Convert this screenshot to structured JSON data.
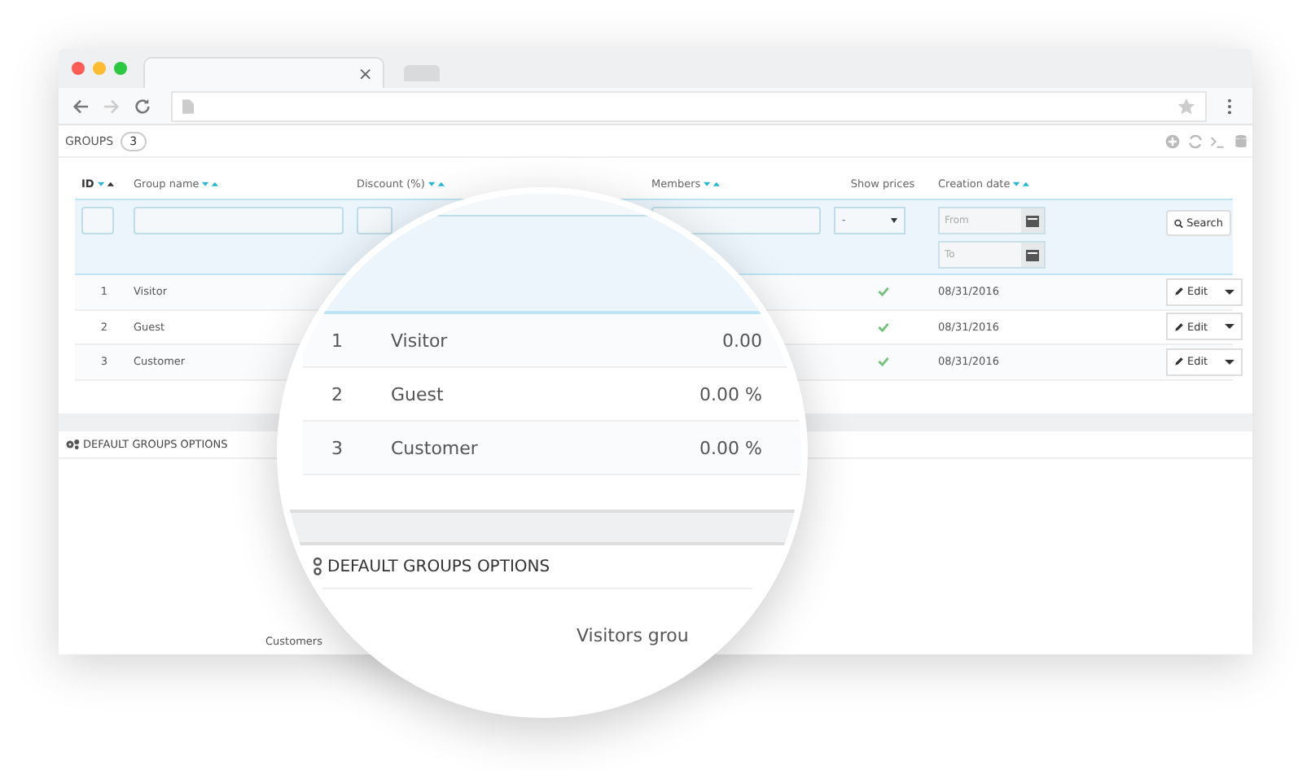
{
  "browser": {
    "tabs": [
      {
        "selected": true,
        "close": "×"
      },
      {
        "selected": false
      }
    ]
  },
  "header": {
    "title": "GROUPS",
    "count": "3"
  },
  "table": {
    "columns": [
      {
        "label": "ID",
        "sortable": true,
        "sorted": true
      },
      {
        "label": "Group name",
        "sortable": true,
        "sorted": false
      },
      {
        "label": "Discount (%)",
        "sortable": true,
        "sorted": false
      },
      {
        "label": "Members",
        "sortable": true,
        "sorted": false
      },
      {
        "label": "Show prices",
        "sortable": false,
        "sorted": false
      },
      {
        "label": "Creation date",
        "sortable": true,
        "sorted": false
      }
    ],
    "filters": {
      "select_value": "-",
      "date_from_placeholder": "From",
      "date_to_placeholder": "To",
      "search_button": "Search"
    },
    "rows": [
      {
        "id": "1",
        "name": "Visitor",
        "show_prices": true,
        "date": "08/31/2016",
        "action": "Edit"
      },
      {
        "id": "2",
        "name": "Guest",
        "show_prices": true,
        "date": "08/31/2016",
        "action": "Edit"
      },
      {
        "id": "3",
        "name": "Customer",
        "show_prices": true,
        "date": "08/31/2016",
        "action": "Edit"
      }
    ]
  },
  "options_panel": {
    "title": "DEFAULT GROUPS OPTIONS",
    "label": "Customers"
  },
  "magnifier": {
    "rows": [
      {
        "id": "1",
        "name": "Visitor",
        "discount": "0.00"
      },
      {
        "id": "2",
        "name": "Guest",
        "discount": "0.00 %"
      },
      {
        "id": "3",
        "name": "Customer",
        "discount": "0.00 %"
      }
    ],
    "title": "DEFAULT GROUPS OPTIONS",
    "label": "Visitors grou"
  }
}
